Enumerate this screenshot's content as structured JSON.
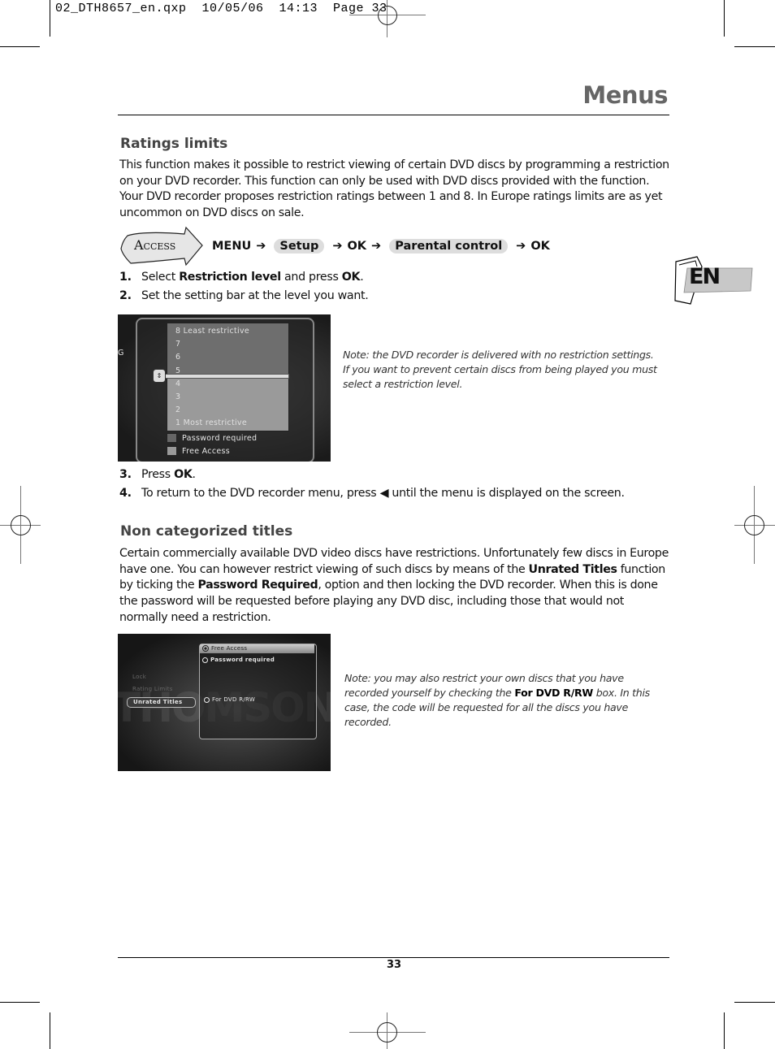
{
  "slug": "02_DTH8657_en.qxp  10/05/06  14:13  Page 33",
  "header": {
    "title": "Menus"
  },
  "language_tab": {
    "label": "EN"
  },
  "section1": {
    "heading": "Ratings limits",
    "paragraph": "This function makes it possible to restrict viewing of certain DVD discs by programming a restriction on your DVD recorder. This function can only be used with DVD discs provided with the function. Your DVD recorder proposes restriction ratings between 1 and 8. In Europe ratings limits are as yet uncommon on DVD discs on sale.",
    "access": {
      "badge": "Access",
      "path": [
        {
          "label": "MENU",
          "pill": false
        },
        {
          "label": "Setup",
          "pill": true
        },
        {
          "label": "OK",
          "pill": false
        },
        {
          "label": "Parental control",
          "pill": true
        },
        {
          "label": "OK",
          "pill": false
        }
      ],
      "arrow": "➔"
    },
    "steps": [
      {
        "num": "1.",
        "pre": "Select ",
        "bold": "Restriction level",
        "mid": " and press ",
        "bold2": "OK",
        "post": "."
      },
      {
        "num": "2.",
        "pre": "Set the setting bar at the level you want.",
        "bold": "",
        "mid": "",
        "bold2": "",
        "post": ""
      }
    ],
    "screen": {
      "left_label": "G",
      "levels": [
        "8 Least restrictive",
        "7",
        "6",
        "5",
        "4",
        "3",
        "2",
        "1 Most restrictive"
      ],
      "selected_level": 5,
      "options": [
        "Password required",
        "Free Access"
      ]
    },
    "note": "Note: the DVD recorder is delivered with no restriction settings. If you want to prevent certain discs from being played you must select a restriction level.",
    "steps2": [
      {
        "num": "3.",
        "pre": "Press ",
        "bold": "OK",
        "post": "."
      },
      {
        "num": "4.",
        "pre": "To return to the DVD recorder menu, press ◀ until the menu is displayed on the screen.",
        "bold": "",
        "post": ""
      }
    ]
  },
  "section2": {
    "heading": "Non categorized titles",
    "p1": "Certain commercially available DVD video discs have restrictions. Unfortunately few discs in Europe have one. You can however restrict viewing of such discs by means of the ",
    "b1": "Unrated Titles",
    "p2": " function by ticking the ",
    "b2": "Password Required",
    "p3": ", option and then locking the DVD recorder. When this is done the password will be requested before playing any DVD disc, including those that would not normally need a restriction.",
    "screen": {
      "menu_items": [
        "Lock",
        "Rating Limits",
        "Unrated Titles"
      ],
      "selected_menu": "Unrated Titles",
      "options": [
        "Free Access",
        "Password required"
      ],
      "selected_option": "Free Access",
      "checkbox": "For DVD R/RW",
      "watermark": "THOMSON"
    },
    "note_pre": "Note: you may also restrict your own discs that you have recorded yourself by checking the ",
    "note_bold": "For DVD R/RW",
    "note_post": " box. In this case, the code will be requested for all the discs you have recorded."
  },
  "footer": {
    "page_number": "33"
  }
}
